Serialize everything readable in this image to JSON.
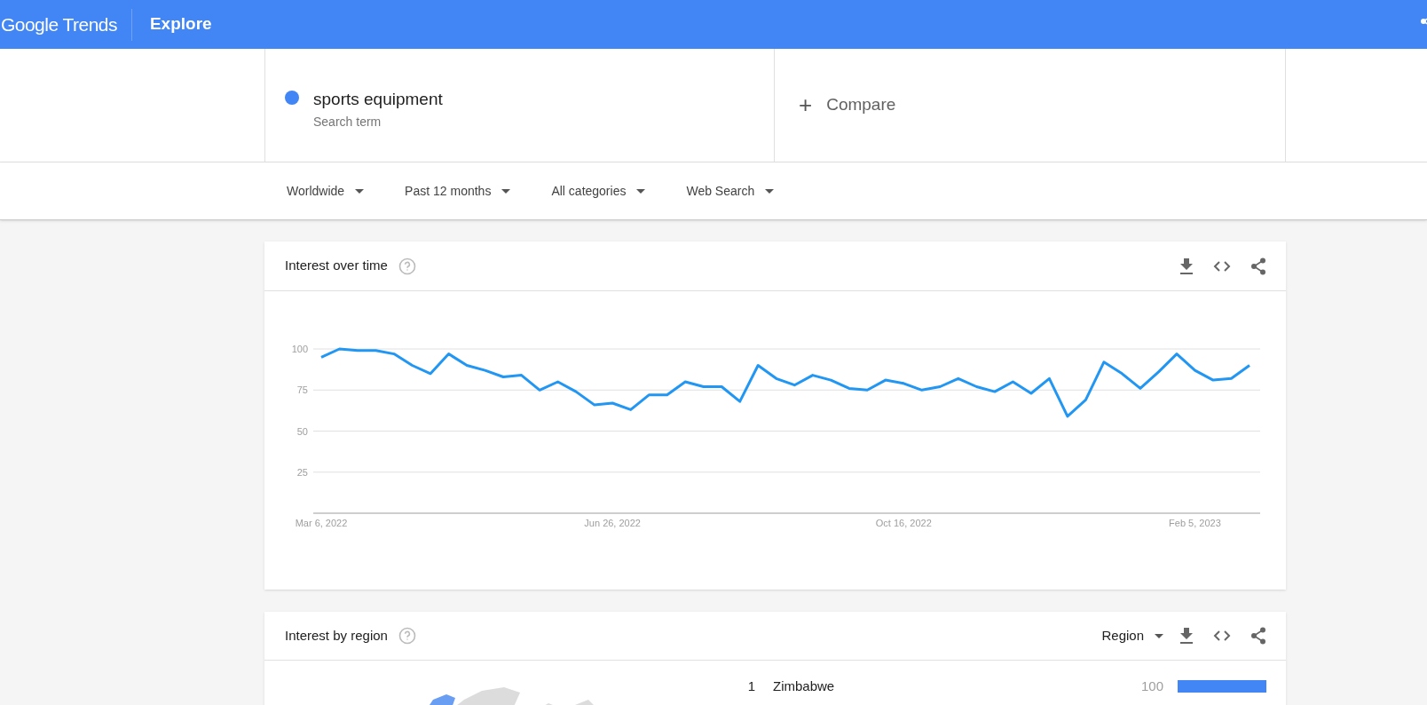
{
  "header": {
    "logo": "Google Trends",
    "title": "Explore"
  },
  "search_terms": [
    {
      "term": "sports equipment",
      "subtitle": "Search term",
      "color": "#4285f4"
    }
  ],
  "compare": {
    "icon": "+",
    "label": "Compare"
  },
  "filters": [
    {
      "label": "Worldwide"
    },
    {
      "label": "Past 12 months"
    },
    {
      "label": "All categories"
    },
    {
      "label": "Web Search"
    }
  ],
  "interest_over_time": {
    "title": "Interest over time",
    "chart_data": {
      "type": "line",
      "ylim": [
        0,
        100
      ],
      "yticks": [
        25,
        50,
        75,
        100
      ],
      "grid": true,
      "categories": [
        "Mar 6, 2022",
        null,
        null,
        null,
        null,
        null,
        null,
        null,
        null,
        null,
        null,
        null,
        null,
        null,
        null,
        null,
        "Jun 26, 2022",
        null,
        null,
        null,
        null,
        null,
        null,
        null,
        null,
        null,
        null,
        null,
        null,
        null,
        null,
        null,
        "Oct 16, 2022",
        null,
        null,
        null,
        null,
        null,
        null,
        null,
        null,
        null,
        null,
        null,
        null,
        null,
        null,
        null,
        "Feb 5, 2023",
        null,
        null,
        null
      ],
      "series": [
        {
          "color": "#2196f3",
          "values": [
            95,
            100,
            99,
            99,
            97,
            90,
            85,
            97,
            90,
            87,
            83,
            84,
            75,
            80,
            74,
            66,
            67,
            63,
            72,
            72,
            80,
            77,
            77,
            68,
            90,
            82,
            78,
            84,
            81,
            76,
            75,
            81,
            79,
            75,
            77,
            82,
            77,
            74,
            80,
            73,
            82,
            59,
            69,
            92,
            85,
            76,
            86,
            97,
            87,
            81,
            82,
            90
          ]
        }
      ]
    }
  },
  "interest_by_region": {
    "title": "Interest by region",
    "dropdown": "Region",
    "rows": [
      {
        "rank": "1",
        "name": "Zimbabwe",
        "value": "100",
        "level": 1
      }
    ]
  }
}
